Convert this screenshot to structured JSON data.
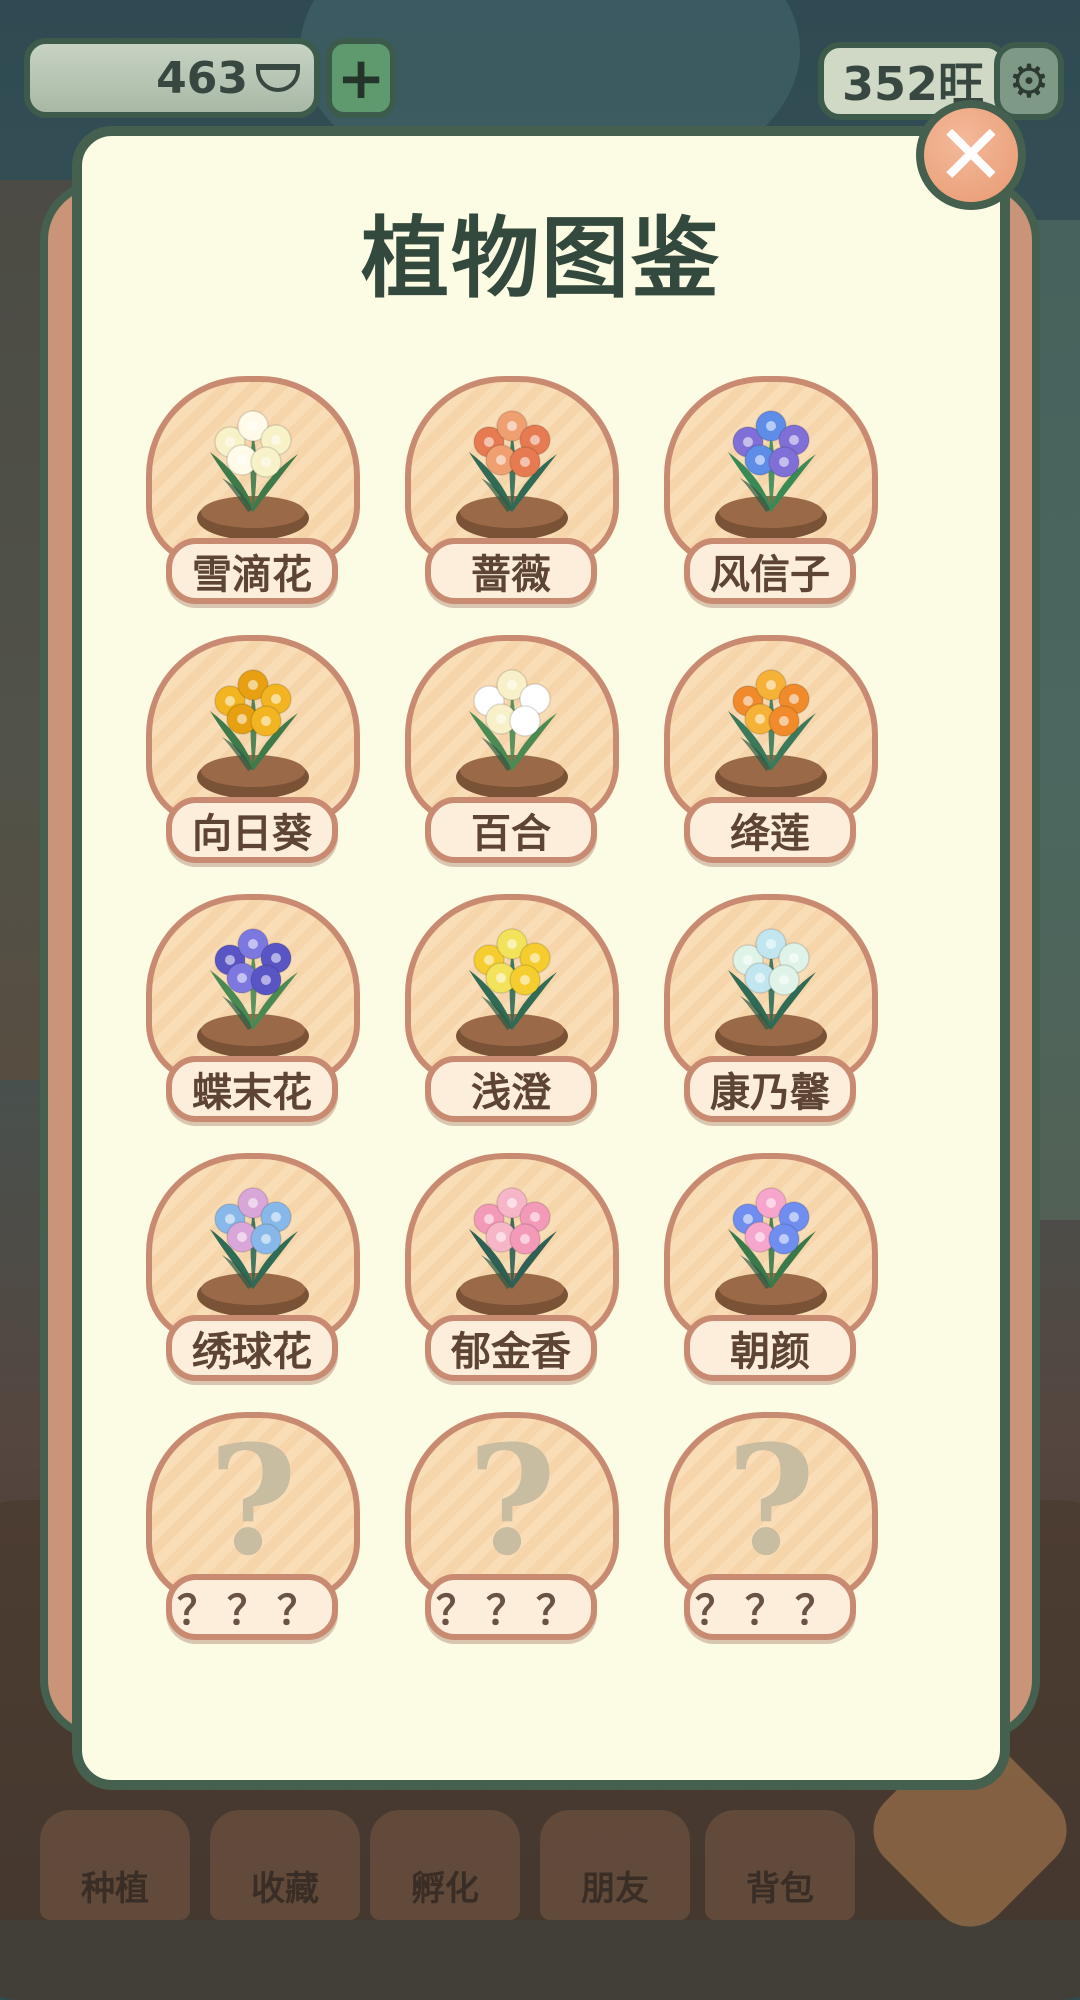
{
  "top_bar": {
    "coins": "463",
    "plus_label": "+",
    "wang": "352旺",
    "gear": "⚙"
  },
  "panel": {
    "title": "植物图鉴",
    "close_label": "✕"
  },
  "plants": [
    {
      "name": "雪滴花",
      "locked": false,
      "colors": [
        "#f7f2c8",
        "#fffbe8",
        "#3f7a4a"
      ]
    },
    {
      "name": "蔷薇",
      "locked": false,
      "colors": [
        "#e67a50",
        "#f0a070",
        "#2f6b55"
      ]
    },
    {
      "name": "风信子",
      "locked": false,
      "colors": [
        "#7f6fd6",
        "#5e8de8",
        "#3a8a56"
      ]
    },
    {
      "name": "向日葵",
      "locked": false,
      "colors": [
        "#f2b521",
        "#e6a012",
        "#3f7a4a"
      ]
    },
    {
      "name": "百合",
      "locked": false,
      "colors": [
        "#ffffff",
        "#f7f0c8",
        "#4b8a52"
      ]
    },
    {
      "name": "绛莲",
      "locked": false,
      "colors": [
        "#f08a2a",
        "#f6b236",
        "#3a7a5a"
      ]
    },
    {
      "name": "蝶末花",
      "locked": false,
      "colors": [
        "#5a55c4",
        "#7d78e0",
        "#4a8a52"
      ]
    },
    {
      "name": "浅澄",
      "locked": false,
      "colors": [
        "#f6cd2e",
        "#f2e35a",
        "#2f6b55"
      ]
    },
    {
      "name": "康乃馨",
      "locked": false,
      "colors": [
        "#dff3e8",
        "#c2e6f0",
        "#2f6b55"
      ]
    },
    {
      "name": "绣球花",
      "locked": false,
      "colors": [
        "#88b8ea",
        "#d8a6d8",
        "#2f6b55"
      ]
    },
    {
      "name": "郁金香",
      "locked": false,
      "colors": [
        "#f29ab8",
        "#f6b6c8",
        "#2f5f55"
      ]
    },
    {
      "name": "朝颜",
      "locked": false,
      "colors": [
        "#6f8ef0",
        "#f6a6cc",
        "#3a7a4a"
      ]
    },
    {
      "name": "？？？",
      "locked": true
    },
    {
      "name": "？？？",
      "locked": true
    },
    {
      "name": "？？？",
      "locked": true
    }
  ],
  "locked_symbol": "?",
  "bottom_nav": [
    "种植",
    "收藏",
    "孵化",
    "朋友",
    "背包"
  ]
}
